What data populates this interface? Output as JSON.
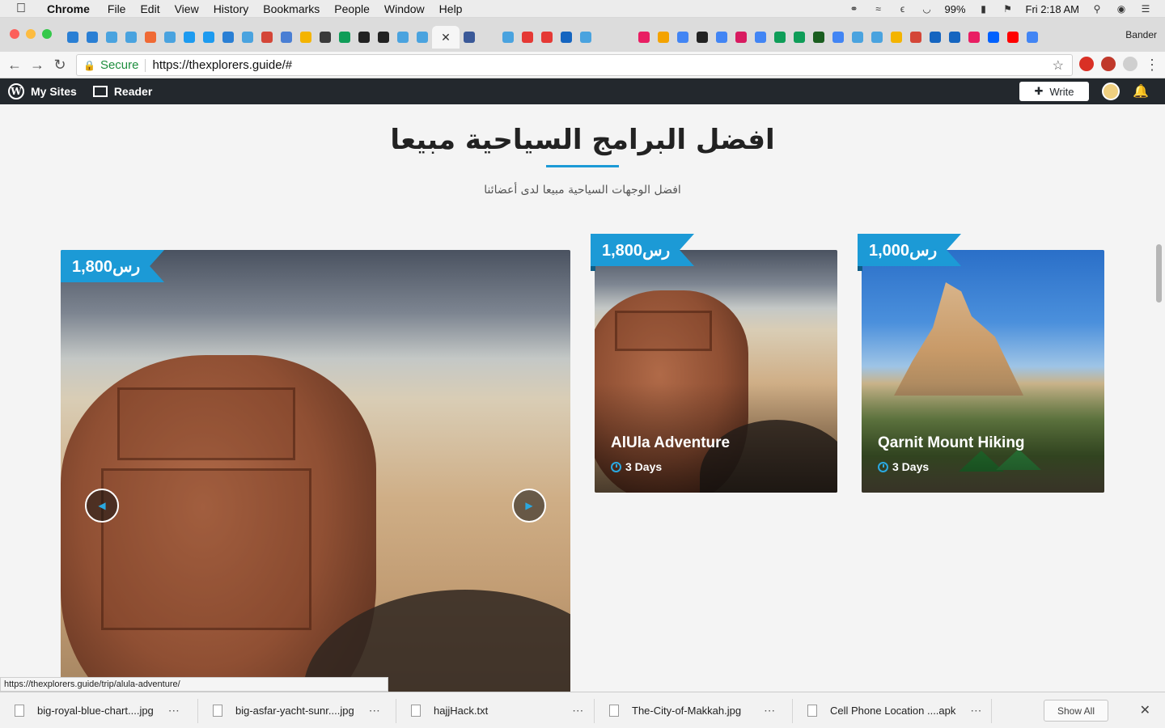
{
  "menubar": {
    "app": "Chrome",
    "menus": [
      "File",
      "Edit",
      "View",
      "History",
      "Bookmarks",
      "People",
      "Window",
      "Help"
    ],
    "battery": "99%",
    "clock": "Fri 2:18 AM"
  },
  "browser": {
    "profile": "Bander",
    "secure_label": "Secure",
    "url": "https://thexplorers.guide/#",
    "status_url": "https://thexplorers.guide/trip/alula-adventure/"
  },
  "wpbar": {
    "my_sites": "My Sites",
    "reader": "Reader",
    "write": "Write"
  },
  "section": {
    "title": "افضل البرامج السياحية مبيعا",
    "subtitle": "افضل الوجهات السياحية مبيعا لدى أعضائنا",
    "accent": "#1c9ad6"
  },
  "trips": [
    {
      "price": "1,800رس",
      "title": "",
      "days": ""
    },
    {
      "price": "1,800رس",
      "title": "AlUla Adventure",
      "days": "3 Days"
    },
    {
      "price": "1,000رس",
      "title": "Qarnit Mount Hiking",
      "days": "3 Days"
    }
  ],
  "downloads": [
    "big-royal-blue-chart....jpg",
    "big-asfar-yacht-sunr....jpg",
    "hajjHack.txt",
    "The-City-of-Makkah.jpg",
    "Cell Phone Location ....apk"
  ],
  "shelf": {
    "show_all": "Show All"
  }
}
